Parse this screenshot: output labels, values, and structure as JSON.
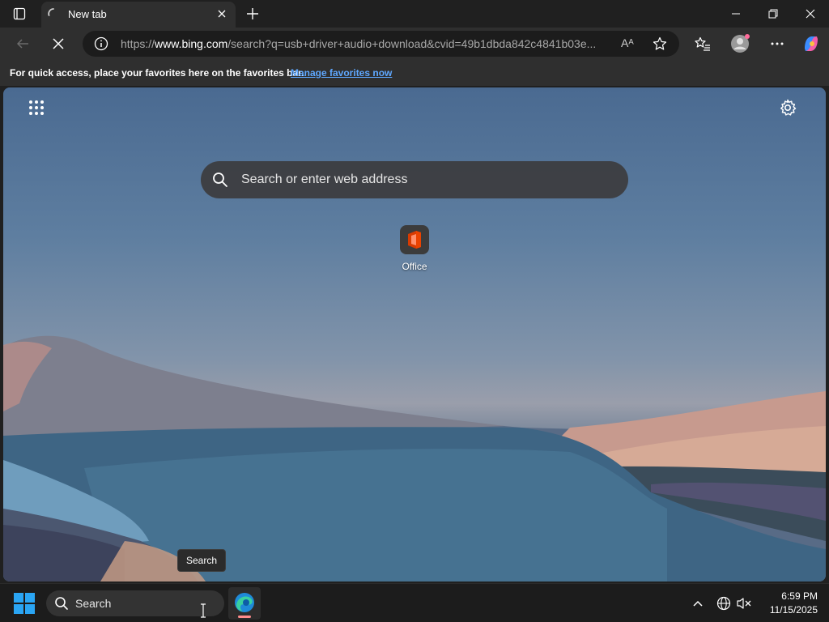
{
  "browser": {
    "tab": {
      "title": "New tab"
    },
    "address": {
      "url_prefix": "https://",
      "url_domain": "www.bing.com",
      "url_rest": "/search?q=usb+driver+audio+download&cvid=49b1dbda842c4841b03e...",
      "read_aloud_glyph": "Aᴬ"
    },
    "favorites_bar": {
      "hint": "For quick access, place your favorites here on the favorites bar.",
      "link": "Manage favorites now"
    }
  },
  "new_tab_page": {
    "search_placeholder": "Search or enter web address",
    "tiles": [
      {
        "label": "Office",
        "icon": "office-icon"
      }
    ],
    "tooltip": "Search"
  },
  "taskbar": {
    "search_label": "Search",
    "clock": {
      "time": "6:59 PM",
      "date": "11/15/2025"
    }
  },
  "colors": {
    "accent": "#5fa8ff",
    "start_blue": "#2aa5f4",
    "edge_indicator": "#ff8c8c"
  }
}
